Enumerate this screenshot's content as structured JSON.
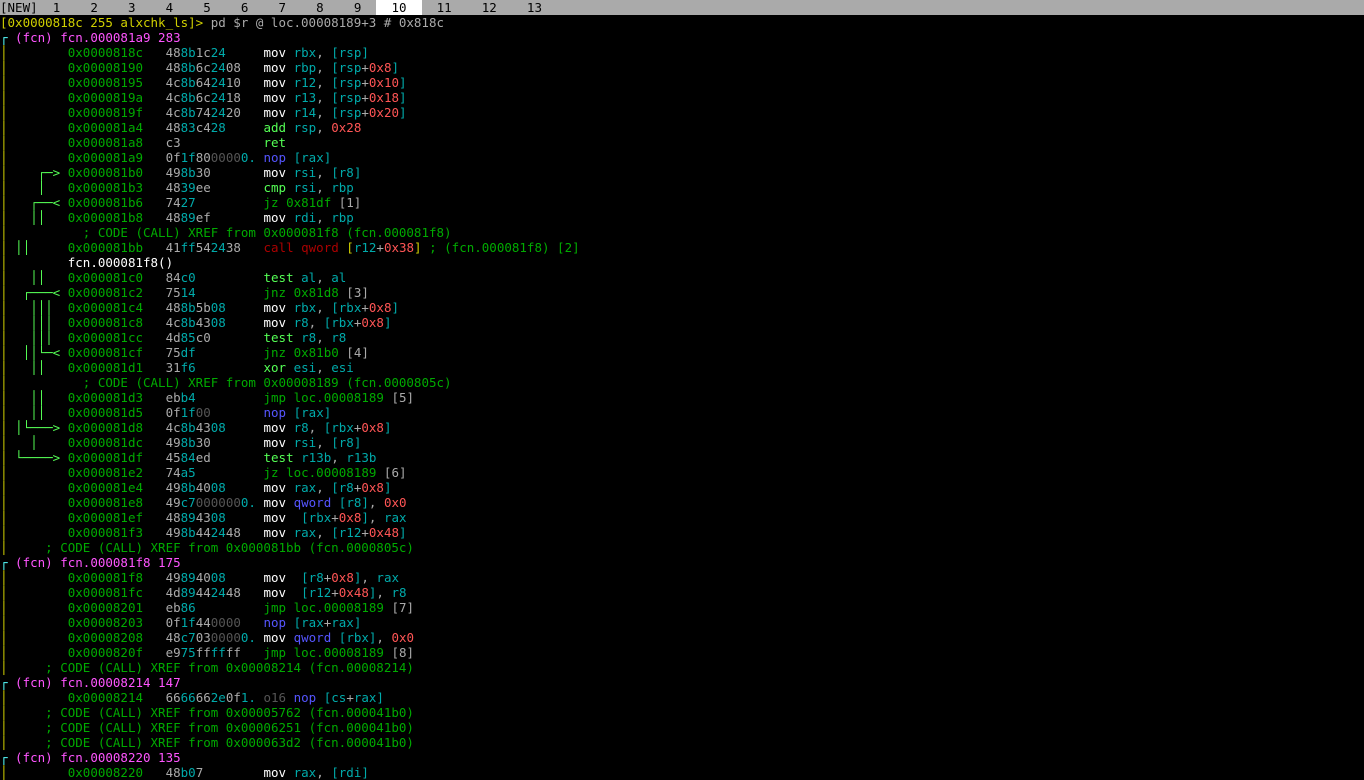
{
  "tabbar": {
    "left": "[NEW]",
    "tabs": [
      " 1 ",
      " 2 ",
      " 3 ",
      " 4 ",
      " 5 ",
      " 6 ",
      " 7 ",
      " 8 ",
      " 9 ",
      " 10 ",
      " 11 ",
      " 12 ",
      " 13 "
    ],
    "selected": " 10 "
  },
  "prompt": {
    "addr": "[0x0000818c 255 alxchk_ls]> ",
    "cmd": "pd $r @ loc.00008189+3 # 0x818c"
  },
  "fn1": {
    "head": "┌ (fcn) fcn.000081a9 283",
    "rows": [
      {
        "arrow": "",
        "a": "0x0000818c",
        "hx": "488b1c24",
        "nop": "",
        "op": "mov",
        "reg": "rbx",
        "rest": ",",
        "br": " [",
        "brinner": "rsp",
        "after": "]"
      },
      {
        "arrow": "",
        "a": "0x00008190",
        "hx": "488b6c2408",
        "nop": "",
        "op": "mov",
        "reg": "rbp",
        "rest": ",",
        "br": " [",
        "brinner": "rsp",
        "plus": "+",
        "off": "0x8",
        "after": "]"
      },
      {
        "arrow": "",
        "a": "0x00008195",
        "hx": "4c8b642410",
        "nop": "",
        "op": "mov",
        "reg": "r12",
        "rest": ",",
        "br": " [",
        "brinner": "rsp",
        "plus": "+",
        "off": "0x10",
        "after": "]"
      },
      {
        "arrow": "",
        "a": "0x0000819a",
        "hx": "4c8b6c2418",
        "nop": "",
        "op": "mov",
        "reg": "r13",
        "rest": ",",
        "br": " [",
        "brinner": "rsp",
        "plus": "+",
        "off": "0x18",
        "after": "]"
      },
      {
        "arrow": "",
        "a": "0x0000819f",
        "hx": "4c8b742420",
        "nop": "",
        "op": "mov",
        "reg": "r14",
        "rest": ",",
        "br": " [",
        "brinner": "rsp",
        "plus": "+",
        "off": "0x20",
        "after": "]"
      },
      {
        "arrow": "",
        "a": "0x000081a4",
        "hx": "4883c428",
        "nop": "",
        "op2": "add",
        "reg": "rsp",
        "rest": ",",
        "num": " 0x28"
      },
      {
        "arrow": "",
        "a": "0x000081a8",
        "hx": "c3",
        "nop": "",
        "op2": "ret"
      },
      {
        "arrow": "",
        "a": "0x000081a9",
        "hx": "0f1f8000000.",
        "nop": "nop",
        "br": " [",
        "brinner": "rax",
        "after": "]"
      },
      {
        "arrow": "┌─> ",
        "a": "0x000081b0",
        "hx": "498b30",
        "nop": "",
        "op": "mov",
        "reg": "rsi",
        "rest": ",",
        "br": " [",
        "brinner": "r8",
        "after": "]"
      },
      {
        "arrow": "│   ",
        "a": "0x000081b3",
        "hx": "4839ee",
        "nop": "",
        "op2": "cmp",
        "reg": "rsi",
        "rest": ",",
        "reg2": " rbp"
      },
      {
        "arrow": "┌──< ",
        "a": "0x000081b6",
        "hx": "7427",
        "nop": "",
        "op3": "jz 0x81df",
        "ann": " [1]"
      },
      {
        "arrow": "││   ",
        "a": "0x000081b8",
        "hx": "4889ef",
        "nop": "",
        "op": "mov",
        "reg": "rdi",
        "rest": ",",
        "reg2": " rbp"
      }
    ],
    "xref1": "; CODE (CALL) XREF from 0x000081f8 (fcn.000081f8)",
    "call": {
      "arrow": "││   ",
      "a": "0x000081bb",
      "hx": "41ff542438",
      "c1": "call qword",
      "br": " [",
      "binner": "r12",
      "plus": "+",
      "off": "0x38",
      "after": "]",
      "comment": " ; (fcn.000081f8) [2]"
    },
    "fnref": "fcn.000081f8()",
    "rows2": [
      {
        "arrow": "││   ",
        "a": "0x000081c0",
        "hx": "84c0",
        "op2": "test",
        "reg": "al",
        "rest": ",",
        "reg2": " al"
      },
      {
        "arrow": "┌───< ",
        "a": "0x000081c2",
        "hx": "7514",
        "op3": "jnz 0x81d8",
        "ann": " [3]"
      },
      {
        "arrow": "│││  ",
        "a": "0x000081c4",
        "hx": "488b5b08",
        "op": "mov",
        "reg": "rbx",
        "rest": ",",
        "br": " [",
        "brinner": "rbx",
        "plus": "+",
        "off": "0x8",
        "after": "]"
      },
      {
        "arrow": "│││  ",
        "a": "0x000081c8",
        "hx": "4c8b4308",
        "op": "mov",
        "reg": "r8",
        "rest": ",",
        "br": " [",
        "brinner": "rbx",
        "plus": "+",
        "off": "0x8",
        "after": "]"
      },
      {
        "arrow": "│││  ",
        "a": "0x000081cc",
        "hx": "4d85c0",
        "op2": "test",
        "reg": "r8",
        "rest": ",",
        "reg2": " r8"
      },
      {
        "arrow": "││└─< ",
        "a": "0x000081cf",
        "hx": "75df",
        "op3": "jnz 0x81b0",
        "ann": " [4]"
      },
      {
        "arrow": "││   ",
        "a": "0x000081d1",
        "hx": "31f6",
        "op2": "xor",
        "reg": "esi",
        "rest": ",",
        "reg2": " esi"
      }
    ],
    "xref2": "; CODE (CALL) XREF from 0x00008189 (fcn.0000805c)",
    "rows3": [
      {
        "arrow": "││   ",
        "a": "0x000081d3",
        "hx": "ebb4",
        "op3": "jmp loc.00008189",
        "ann": " [5]"
      },
      {
        "arrow": "││   ",
        "a": "0x000081d5",
        "hx": "0f1f00",
        "nop": "nop",
        "br": " [",
        "brinner": "rax",
        "after": "]"
      },
      {
        "arrow": "│└───> ",
        "a": "0x000081d8",
        "hx": "4c8b4308",
        "op": "mov",
        "reg": "r8",
        "rest": ",",
        "br": " [",
        "brinner": "rbx",
        "plus": "+",
        "off": "0x8",
        "after": "]"
      },
      {
        "arrow": "│    ",
        "a": "0x000081dc",
        "hx": "498b30",
        "op": "mov",
        "reg": "rsi",
        "rest": ",",
        "br": " [",
        "brinner": "r8",
        "after": "]"
      },
      {
        "arrow": "└────> ",
        "a": "0x000081df",
        "hx": "4584ed",
        "op2": "test",
        "reg": "r13b",
        "rest": ",",
        "reg2": " r13b"
      },
      {
        "arrow": "",
        "a": "0x000081e2",
        "hx": "74a5",
        "op3": "jz loc.00008189",
        "ann": " [6]"
      },
      {
        "arrow": "",
        "a": "0x000081e4",
        "hx": "498b4008",
        "op": "mov",
        "reg": "rax",
        "rest": ",",
        "br": " [",
        "brinner": "r8",
        "plus": "+",
        "off": "0x8",
        "after": "]"
      },
      {
        "arrow": "",
        "a": "0x000081e8",
        "hx": "49c70000000.",
        "op": "mov",
        "kw": "qword",
        "br": " [",
        "brinner": "r8",
        "after": "]",
        "rest": ",",
        "num": " 0x0"
      },
      {
        "arrow": "",
        "a": "0x000081ef",
        "hx": "48894308",
        "op": "mov",
        "br": " [",
        "brinner": "rbx",
        "plus": "+",
        "off": "0x8",
        "after": "]",
        "rest": ",",
        "reg2": " rax"
      },
      {
        "arrow": "",
        "a": "0x000081f3",
        "hx": "498b442448",
        "op": "mov",
        "reg": "rax",
        "rest": ",",
        "br": " [",
        "brinner": "r12",
        "plus": "+",
        "off": "0x48",
        "after": "]"
      }
    ],
    "xref3": "; CODE (CALL) XREF from 0x000081bb (fcn.0000805c)"
  },
  "fn2": {
    "head": "┌ (fcn) fcn.000081f8 175",
    "rows": [
      {
        "arrow": "",
        "a": "0x000081f8",
        "hx": "49894008",
        "op": "mov",
        "br": " [",
        "brinner": "r8",
        "plus": "+",
        "off": "0x8",
        "after": "]",
        "rest": ",",
        "reg2": " rax"
      },
      {
        "arrow": "",
        "a": "0x000081fc",
        "hx": "4d89442448",
        "op": "mov",
        "br": " [",
        "brinner": "r12",
        "plus": "+",
        "off": "0x48",
        "after": "]",
        "rest": ",",
        "reg2": " r8"
      },
      {
        "arrow": "",
        "a": "0x00008201",
        "hx": "eb86",
        "op3": "jmp loc.00008189",
        "ann": " [7]"
      },
      {
        "arrow": "",
        "a": "0x00008203",
        "hx": "0f1f440000",
        "nop": "nop",
        "br": " [",
        "brinner": "rax",
        "plus": "+",
        "brinner2": "rax",
        "after": "]"
      },
      {
        "arrow": "",
        "a": "0x00008208",
        "hx": "48c70300000.",
        "op": "mov",
        "kw": "qword",
        "br": " [",
        "brinner": "rbx",
        "after": "]",
        "rest": ",",
        "num": " 0x0"
      },
      {
        "arrow": "",
        "a": "0x0000820f",
        "hx": "e975ffffff",
        "op3": "jmp loc.00008189",
        "ann": " [8]"
      }
    ],
    "xref": "; CODE (CALL) XREF from 0x00008214 (fcn.00008214)"
  },
  "fn3": {
    "head": "┌ (fcn) fcn.00008214 147",
    "rows": [
      {
        "arrow": "",
        "a": "0x00008214",
        "hx": "6666662e0f1.",
        "pre": "o16 ",
        "nop": "nop",
        "br": " [",
        "brinner": "cs",
        "colon": ":",
        "brinner2": "rax",
        "plus": "+",
        "brinner3": "rax",
        "after": "]"
      }
    ],
    "xrefs": [
      "; CODE (CALL) XREF from 0x00005762 (fcn.000041b0)",
      "; CODE (CALL) XREF from 0x00006251 (fcn.000041b0)",
      "; CODE (CALL) XREF from 0x000063d2 (fcn.000041b0)"
    ]
  },
  "fn4": {
    "head": "┌ (fcn) fcn.00008220 135",
    "rows": [
      {
        "arrow": "",
        "a": "0x00008220",
        "hx": "48b07",
        "op": "mov",
        "reg": "rax",
        "rest": ",",
        "br": " [",
        "brinner": "rdi",
        "after": "]"
      }
    ]
  }
}
